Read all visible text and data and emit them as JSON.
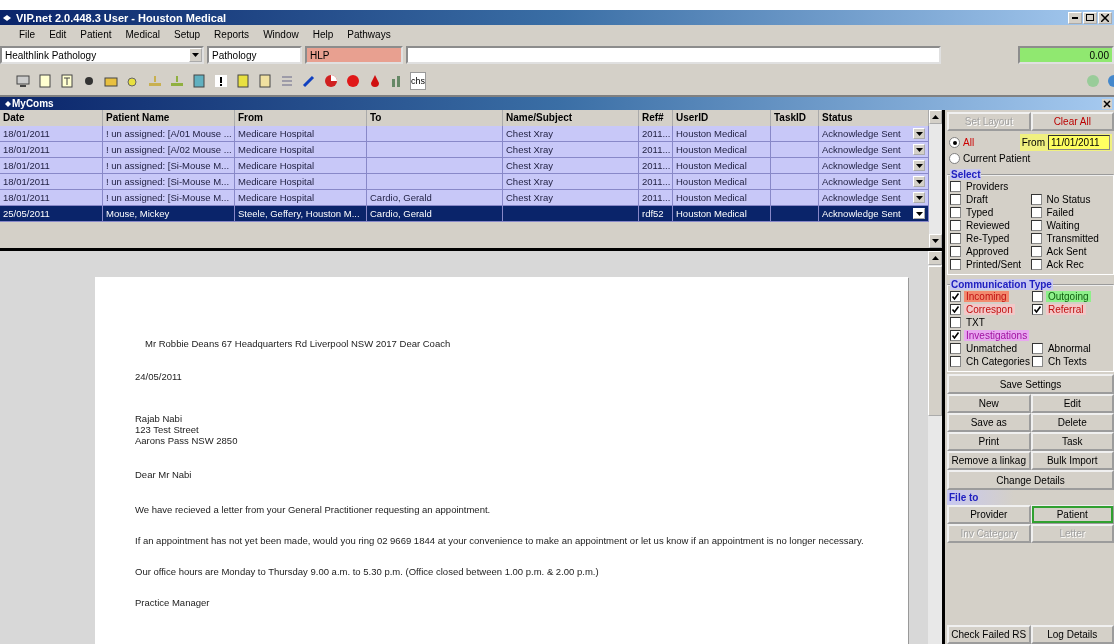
{
  "window": {
    "title": "VIP.net 2.0.448.3 User - Houston Medical"
  },
  "menu": [
    "File",
    "Edit",
    "Patient",
    "Medical",
    "Setup",
    "Reports",
    "Window",
    "Help",
    "Pathways"
  ],
  "fields": {
    "provider_combo": "Healthlink Pathology",
    "category": "Pathology",
    "code": "HLP",
    "amount": "0.00"
  },
  "toolbar_label": "chs",
  "inner_window": {
    "title": "MyComs"
  },
  "table": {
    "columns": [
      "Date",
      "Patient Name",
      "From",
      "To",
      "Name/Subject",
      "Ref#",
      "UserID",
      "TaskID",
      "Status"
    ],
    "rows": [
      {
        "cells": [
          "18/01/2011",
          "! un assigned: [A/01 Mouse ...",
          "Medicare Hospital",
          "",
          "Chest Xray",
          "2011...",
          "Houston Medical",
          "",
          "Acknowledge Sent"
        ],
        "selected": false
      },
      {
        "cells": [
          "18/01/2011",
          "! un assigned: [A/02 Mouse ...",
          "Medicare Hospital",
          "",
          "Chest Xray",
          "2011...",
          "Houston Medical",
          "",
          "Acknowledge Sent"
        ],
        "selected": false
      },
      {
        "cells": [
          "18/01/2011",
          "! un assigned: [Si-Mouse M...",
          "Medicare Hospital",
          "",
          "Chest Xray",
          "2011...",
          "Houston Medical",
          "",
          "Acknowledge Sent"
        ],
        "selected": false
      },
      {
        "cells": [
          "18/01/2011",
          "! un assigned: [Si-Mouse M...",
          "Medicare Hospital",
          "",
          "Chest Xray",
          "2011...",
          "Houston Medical",
          "",
          "Acknowledge Sent"
        ],
        "selected": false
      },
      {
        "cells": [
          "18/01/2011",
          "! un assigned: [Si-Mouse M...",
          "Medicare Hospital",
          "Cardio, Gerald",
          "Chest Xray",
          "2011...",
          "Houston Medical",
          "",
          "Acknowledge Sent"
        ],
        "selected": false
      },
      {
        "cells": [
          "25/05/2011",
          "Mouse, Mickey",
          "Steele, Geffery, Houston M...",
          "Cardio, Gerald",
          "",
          "rdf52",
          "Houston Medical",
          "",
          "Acknowledge Sent"
        ],
        "selected": true
      }
    ]
  },
  "letter": {
    "address_line": "Mr Robbie Deans 67 Headquarters Rd Liverpool NSW 2017  Dear Coach",
    "date": "24/05/2011",
    "recipient": [
      "Rajab Nabi",
      "123 Test Street",
      "Aarons Pass NSW 2850"
    ],
    "salutation": "Dear Mr Nabi",
    "paragraphs": [
      "We have recieved a letter from your General Practitioner requesting an appointment.",
      "If an appointment has not yet been made, would you ring  02 9669 1844 at your convenience to make an appointment or let us know if an appointment is no longer necessary.",
      "Our office hours are Monday to Thursday 9.00 a.m. to 5.30 p.m. (Office closed between 1.00 p.m. & 2.00 p.m.)"
    ],
    "signature": "Practice Manager"
  },
  "side": {
    "top_buttons": [
      {
        "label": "Set Layout",
        "disabled": true
      },
      {
        "label": "Clear All",
        "disabled": false
      }
    ],
    "scope": [
      {
        "label": "All",
        "selected": true
      },
      {
        "label": "Current Patient",
        "selected": false
      }
    ],
    "from_label": "From",
    "from_date": "11/01/2011",
    "select_title": "Select",
    "select": [
      {
        "label": "Providers",
        "checked": false,
        "kind": "wide"
      },
      {
        "label": "Draft",
        "checked": false,
        "kind": "half"
      },
      {
        "label": "No Status",
        "checked": false,
        "kind": "half"
      },
      {
        "label": "Typed",
        "checked": false,
        "kind": "half"
      },
      {
        "label": "Failed",
        "checked": false,
        "kind": "half"
      },
      {
        "label": "Reviewed",
        "checked": false,
        "kind": "half"
      },
      {
        "label": "Waiting",
        "checked": false,
        "kind": "half"
      },
      {
        "label": "Re-Typed",
        "checked": false,
        "kind": "half"
      },
      {
        "label": "Transmitted",
        "checked": false,
        "kind": "half"
      },
      {
        "label": "Approved",
        "checked": false,
        "kind": "half"
      },
      {
        "label": "Ack Sent",
        "checked": false,
        "kind": "half"
      },
      {
        "label": "Printed/Sent",
        "checked": false,
        "kind": "half"
      },
      {
        "label": "Ack Rec",
        "checked": false,
        "kind": "half"
      }
    ],
    "comm_title": "Communication Type",
    "comm": [
      {
        "label": "Incoming",
        "checked": true,
        "kind": "half",
        "color": "#f28a6e"
      },
      {
        "label": "Outgoing",
        "checked": false,
        "kind": "half",
        "color": "#8ef08a"
      },
      {
        "label": "Correspon",
        "checked": true,
        "kind": "half",
        "color": "#f2c8c8"
      },
      {
        "label": "Referral",
        "checked": true,
        "kind": "half",
        "color": "#f2c8c8"
      },
      {
        "label": "TXT",
        "checked": false,
        "kind": "wide"
      },
      {
        "label": "Investigations",
        "checked": true,
        "kind": "wide",
        "color": "#e8a8f0"
      },
      {
        "label": "Unmatched",
        "checked": false,
        "kind": "half"
      },
      {
        "label": "Abnormal",
        "checked": false,
        "kind": "half"
      },
      {
        "label": "Ch Categories",
        "checked": false,
        "kind": "half"
      },
      {
        "label": "Ch Texts",
        "checked": false,
        "kind": "half"
      }
    ],
    "actions": [
      {
        "label": "Save Settings",
        "kind": "wide"
      },
      {
        "label": "New",
        "kind": "half"
      },
      {
        "label": "Edit",
        "kind": "half"
      },
      {
        "label": "Save as",
        "kind": "half"
      },
      {
        "label": "Delete",
        "kind": "half"
      },
      {
        "label": "Print",
        "kind": "half"
      },
      {
        "label": "Task",
        "kind": "half"
      },
      {
        "label": "Remove a linkag",
        "kind": "half"
      },
      {
        "label": "Bulk Import",
        "kind": "half"
      },
      {
        "label": "Change Details",
        "kind": "wide"
      }
    ],
    "file_to_title": "File to",
    "file_to": [
      {
        "label": "Provider",
        "selected": false,
        "disabled": false
      },
      {
        "label": "Patient",
        "selected": true,
        "disabled": false
      },
      {
        "label": "Inv Category",
        "selected": false,
        "disabled": true
      },
      {
        "label": "Letter",
        "selected": false,
        "disabled": true
      }
    ],
    "bottom_buttons": [
      "Check Failed RS",
      "Log Details"
    ]
  }
}
